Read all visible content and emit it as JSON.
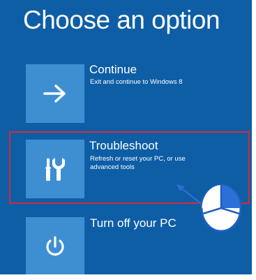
{
  "title": "Choose an option",
  "options": [
    {
      "title": "Continue",
      "description": "Exit and continue to Windows 8",
      "icon": "arrow-right-icon"
    },
    {
      "title": "Troubleshoot",
      "description": "Refresh or reset your PC, or use advanced tools",
      "icon": "tools-icon"
    },
    {
      "title": "Turn off your PC",
      "description": "",
      "icon": "power-icon"
    }
  ],
  "colors": {
    "background": "#0e5ea6",
    "tile": "#3d8fd2",
    "highlight": "#d52a3a",
    "pointer": "#2f6fd0"
  }
}
